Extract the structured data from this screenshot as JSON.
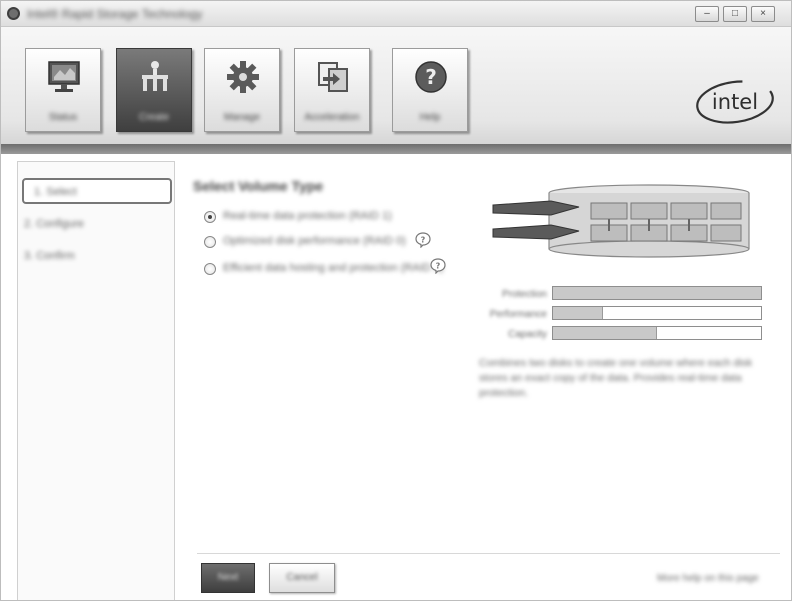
{
  "window": {
    "title": "Intel® Rapid Storage Technology",
    "controls": {
      "minimize": "–",
      "maximize": "□",
      "close": "×"
    }
  },
  "toolbar": {
    "buttons": [
      {
        "label": "Status",
        "icon": "monitor-icon"
      },
      {
        "label": "Create",
        "icon": "create-volume-icon"
      },
      {
        "label": "Manage",
        "icon": "gear-icon"
      },
      {
        "label": "Acceleration",
        "icon": "acceleration-icon"
      },
      {
        "label": "Help",
        "icon": "help-icon"
      }
    ],
    "active_index": 1,
    "logo": "intel"
  },
  "sidebar": {
    "items": [
      "1. Select",
      "2. Configure",
      "3. Confirm"
    ],
    "selected_index": 0
  },
  "main": {
    "title": "Select Volume Type",
    "options": [
      {
        "label": "Real-time data protection (RAID 1)",
        "checked": true
      },
      {
        "label": "Optimized disk performance (RAID 0)",
        "checked": false
      },
      {
        "label": "Efficient data hosting and protection (RAID 5)",
        "checked": false
      }
    ],
    "fields": [
      {
        "label": "Protection",
        "fill": 1.0
      },
      {
        "label": "Performance",
        "fill": 0.24
      },
      {
        "label": "Capacity",
        "fill": 0.5
      }
    ],
    "description": "Combines two disks to create one volume where each disk stores an exact copy of the data. Provides real-time data protection."
  },
  "footer": {
    "next_label": "Next",
    "cancel_label": "Cancel",
    "more_help": "More help on this page"
  },
  "colors": {
    "active_tool": "#4a4a4a",
    "toolbar_bar": "#7a7a7a"
  }
}
